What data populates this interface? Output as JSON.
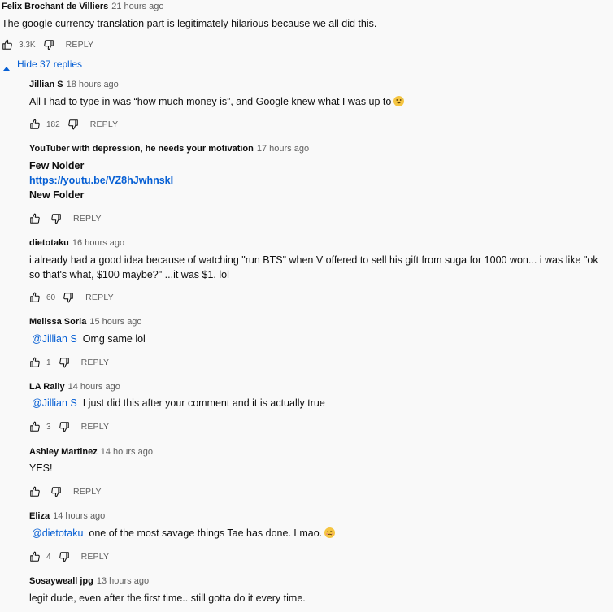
{
  "top_comment": {
    "author": "Felix Brochant de Villiers",
    "time": "21 hours ago",
    "text": "The google currency translation part is legitimately hilarious because we all did this.",
    "likes": "3.3K",
    "reply_label": "REPLY"
  },
  "replies_toggle": {
    "label": "Hide 37 replies"
  },
  "replies": [
    {
      "author": "Jillian S",
      "time": "18 hours ago",
      "text": "All I had to type in was “how much money is”, and Google knew what I was up to",
      "emoji": "grinning-sweat-emoji",
      "likes": "182",
      "reply_label": "REPLY"
    },
    {
      "author": "YouTuber with depression, he needs your motivation",
      "time": "17 hours ago",
      "line1": "Few Nolder",
      "link": "https://youtu.be/VZ8hJwhnskI",
      "line3": "New Folder",
      "likes": "",
      "reply_label": "REPLY"
    },
    {
      "author": "dietotaku",
      "time": "16 hours ago",
      "text": "i already had a good idea because of watching \"run BTS\" when V offered to sell his gift from suga for 1000 won... i was like \"ok so that's what, $100 maybe?\" ...it was $1. lol",
      "likes": "60",
      "reply_label": "REPLY"
    },
    {
      "author": "Melissa Soria",
      "time": "15 hours ago",
      "mention": "@Jillian S",
      "text": "Omg same lol",
      "likes": "1",
      "reply_label": "REPLY"
    },
    {
      "author": "LA Rally",
      "time": "14 hours ago",
      "mention": "@Jillian S",
      "text": "I just did this after your comment and it is actually true",
      "likes": "3",
      "reply_label": "REPLY"
    },
    {
      "author": "Ashley Martinez",
      "time": "14 hours ago",
      "text": "YES!",
      "likes": "",
      "reply_label": "REPLY"
    },
    {
      "author": "Eliza",
      "time": "14 hours ago",
      "mention": "@dietotaku",
      "text": "one of the most savage things Tae has done. Lmao.",
      "emoji": "woozy-face-emoji",
      "likes": "4",
      "reply_label": "REPLY"
    },
    {
      "author": "Sosayweall jpg",
      "time": "13 hours ago",
      "text": "legit dude, even after the first time.. still gotta do it every time."
    }
  ]
}
